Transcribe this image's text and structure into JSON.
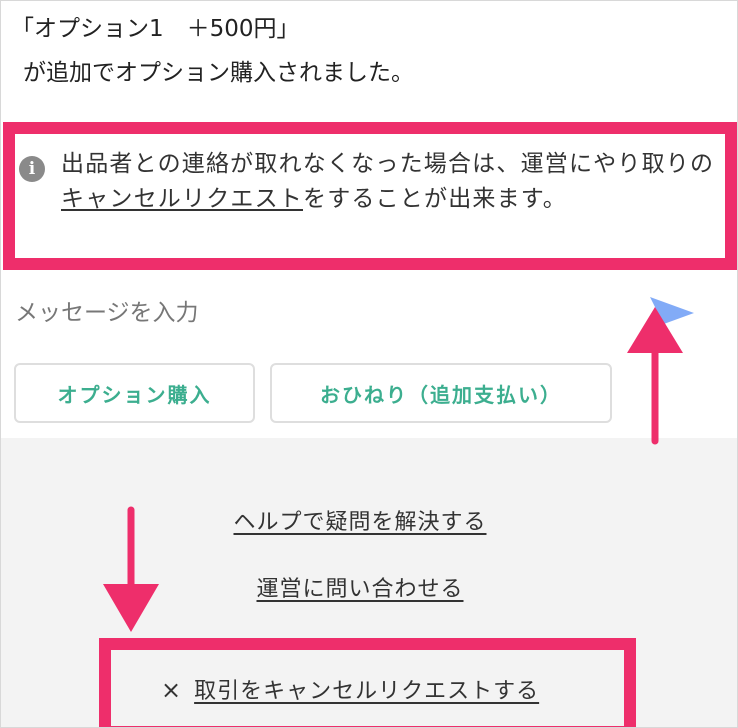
{
  "message": {
    "line1": "「オプション1　＋500円」",
    "line2": "が追加でオプション購入されました。"
  },
  "notice": {
    "icon": "info-icon",
    "text_before": "出品者との連絡が取れなくなった場合は、運営にやり取りの",
    "link": "キャンセルリクエスト",
    "text_after": "をすることが出来ます。",
    "highlight_color": "#ee2e6b"
  },
  "input": {
    "placeholder": "メッセージを入力",
    "value": ""
  },
  "send": {
    "icon": "send-icon",
    "color": "#6c9cf6"
  },
  "buttons": {
    "option_purchase": "オプション購入",
    "tip": "おひねり（追加支払い）",
    "accent": "#3cae8f"
  },
  "links": {
    "help": "ヘルプで疑問を解決する",
    "contact": "運営に問い合わせる",
    "cancel_icon": "×",
    "cancel": "取引をキャンセルリクエストする"
  }
}
